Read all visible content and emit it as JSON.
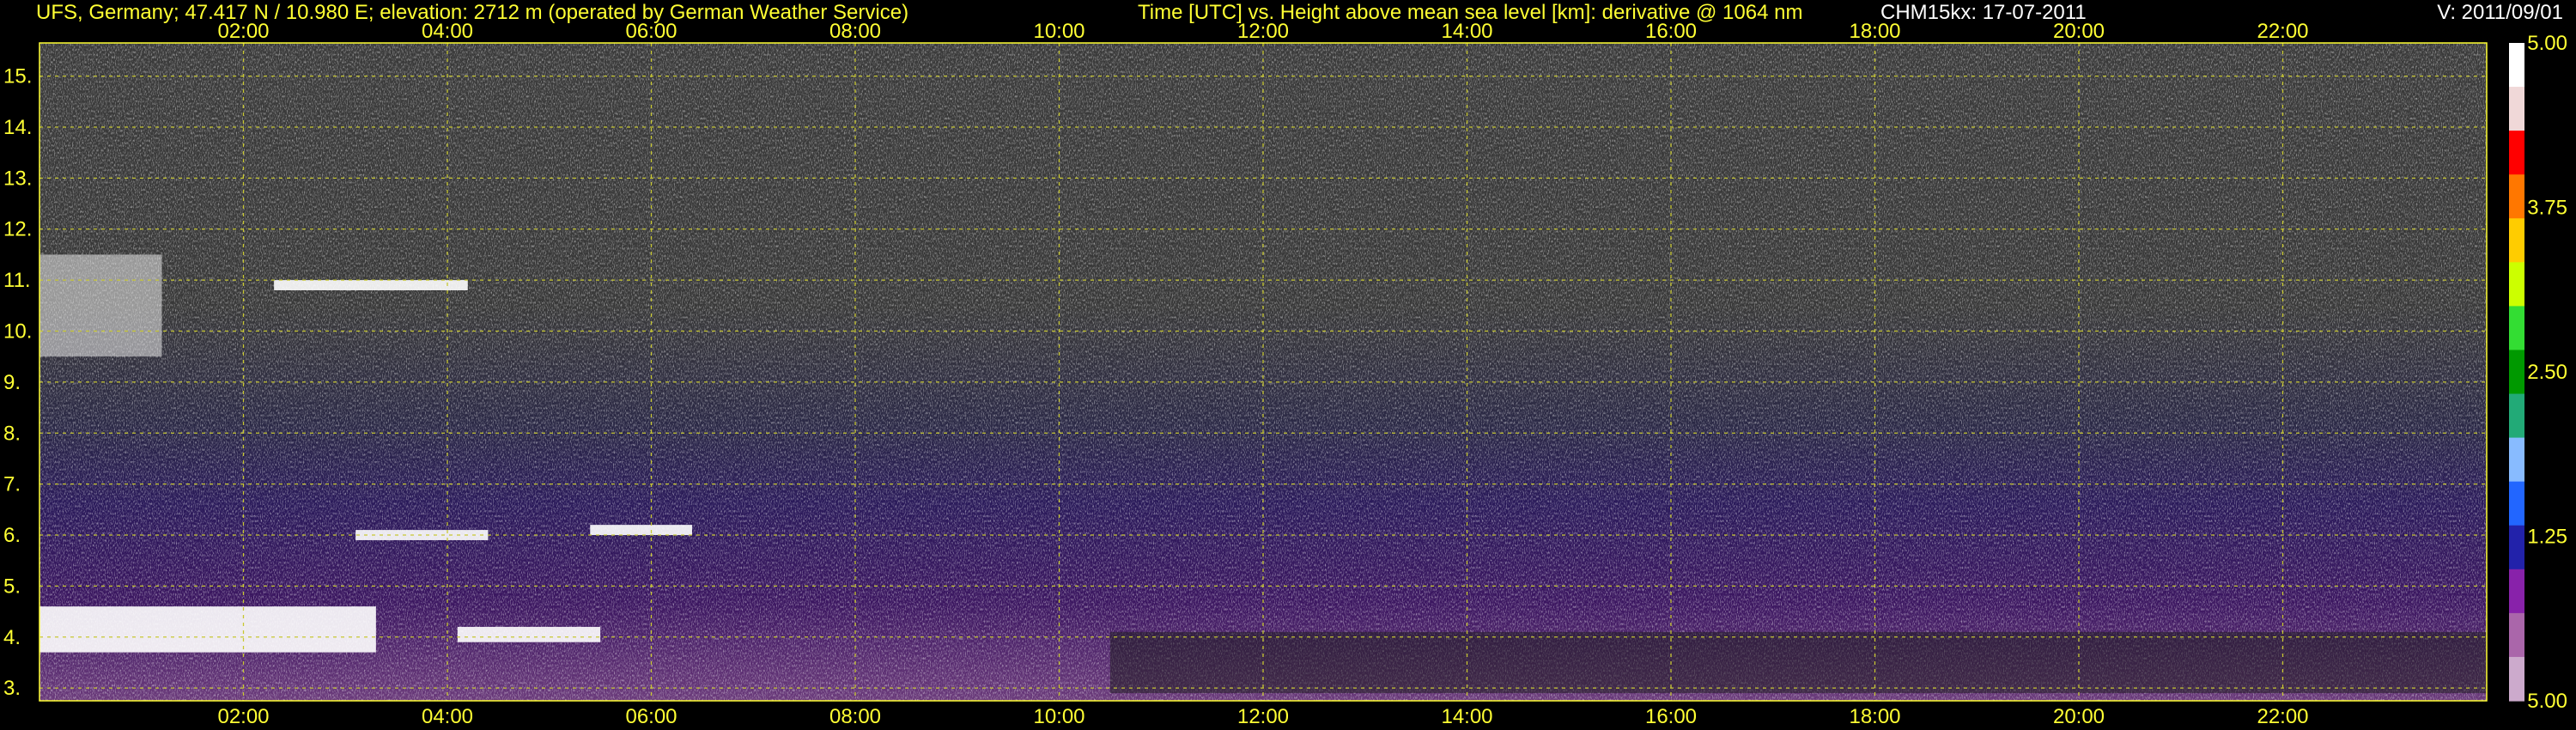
{
  "header": {
    "site": "UFS, Germany; 47.417 N / 10.980 E; elevation: 2712 m  (operated by German Weather Service)",
    "plot_desc": "Time [UTC] vs. Height above mean sea level [km]: derivative @ 1064 nm",
    "instrument_date": "CHM15kx: 17-07-2011",
    "version": "V: 2011/09/01"
  },
  "chart_data": {
    "type": "heatmap",
    "title": "Time [UTC] vs. Height above mean sea level [km]: derivative @ 1064 nm",
    "xlabel": "Time [UTC]",
    "ylabel": "Height above mean sea level [km]",
    "x_ticks": [
      "02:00",
      "04:00",
      "06:00",
      "08:00",
      "10:00",
      "12:00",
      "14:00",
      "16:00",
      "18:00",
      "20:00",
      "22:00"
    ],
    "x_tick_hours": [
      2,
      4,
      6,
      8,
      10,
      12,
      14,
      16,
      18,
      20,
      22
    ],
    "xlim_hours": [
      0,
      24
    ],
    "y_ticks": [
      3,
      4,
      5,
      6,
      7,
      8,
      9,
      10,
      11,
      12,
      13,
      14,
      15
    ],
    "y_tick_labels": [
      "3.",
      "4.",
      "5.",
      "6.",
      "7.",
      "8.",
      "9.",
      "10.",
      "11.",
      "12.",
      "13.",
      "14.",
      "15."
    ],
    "ylim_km": [
      2.75,
      15.65
    ],
    "grid": true,
    "colorbar": {
      "labels": [
        "5.00",
        "3.75",
        "2.50",
        "1.25",
        "5.00"
      ],
      "colors": [
        "#ffffff",
        "#f0d8d8",
        "#ff0000",
        "#ff7700",
        "#ffcc00",
        "#ccff00",
        "#33dd33",
        "#009900",
        "#22aa77",
        "#88bbff",
        "#2266ff",
        "#2222aa",
        "#8822aa",
        "#aa66aa",
        "#ccaacc"
      ]
    },
    "features": [
      {
        "name": "cirrus",
        "t0": 0.0,
        "t1": 1.2,
        "h0": 9.5,
        "h1": 11.5
      },
      {
        "name": "layer",
        "t0": 2.3,
        "t1": 4.2,
        "h0": 10.8,
        "h1": 11.0
      },
      {
        "name": "layer",
        "t0": 3.1,
        "t1": 4.4,
        "h0": 5.9,
        "h1": 6.1
      },
      {
        "name": "layer",
        "t0": 5.4,
        "t1": 6.4,
        "h0": 6.0,
        "h1": 6.2
      },
      {
        "name": "layer",
        "t0": 0.0,
        "t1": 3.3,
        "h0": 3.7,
        "h1": 4.6
      },
      {
        "name": "layer",
        "t0": 4.1,
        "t1": 5.5,
        "h0": 3.9,
        "h1": 4.2
      },
      {
        "name": "boundary",
        "t0": 10.5,
        "t1": 24.0,
        "h0": 2.9,
        "h1": 4.1
      }
    ]
  }
}
